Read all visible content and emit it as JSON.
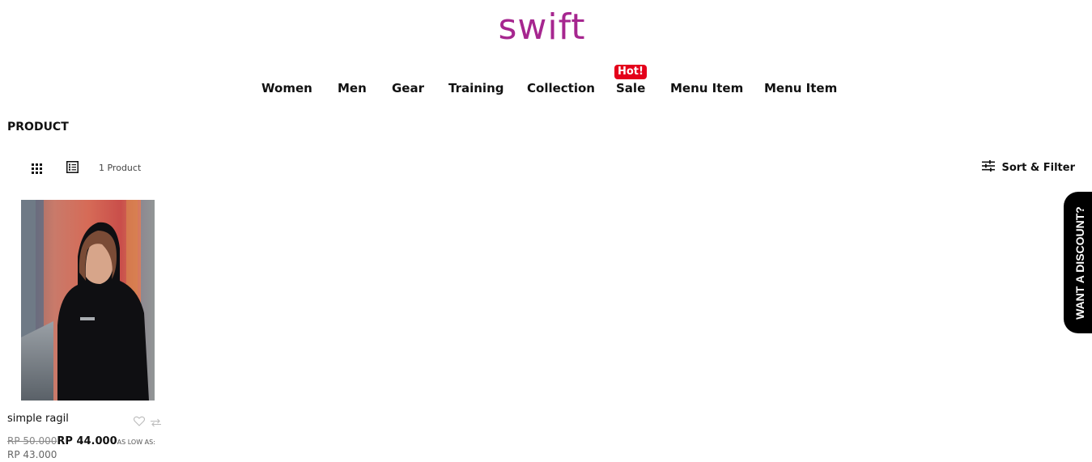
{
  "brand": {
    "logo_text": "swift",
    "color": "#a6268f"
  },
  "nav": {
    "items": [
      {
        "label": "Women"
      },
      {
        "label": "Men"
      },
      {
        "label": "Gear"
      },
      {
        "label": "Training"
      },
      {
        "label": "Collection"
      },
      {
        "label": "Sale",
        "badge": "Hot!"
      },
      {
        "label": "Menu Item"
      },
      {
        "label": "Menu Item"
      }
    ],
    "badge_color": "#e4001b"
  },
  "page": {
    "title": "PRODUCT"
  },
  "toolbar": {
    "product_count": "1 Product",
    "sort_filter_label": "Sort & Filter",
    "view_modes": [
      "grid-view-icon",
      "list-view-icon"
    ]
  },
  "products": [
    {
      "name": "simple ragil",
      "old_price": "RP 50.000",
      "price": "RP 44.000",
      "as_low_as_label": "AS LOW AS:",
      "low_price": "RP 43.000"
    }
  ],
  "discount_tab": {
    "label": "WANT A DISCOUNT?"
  }
}
